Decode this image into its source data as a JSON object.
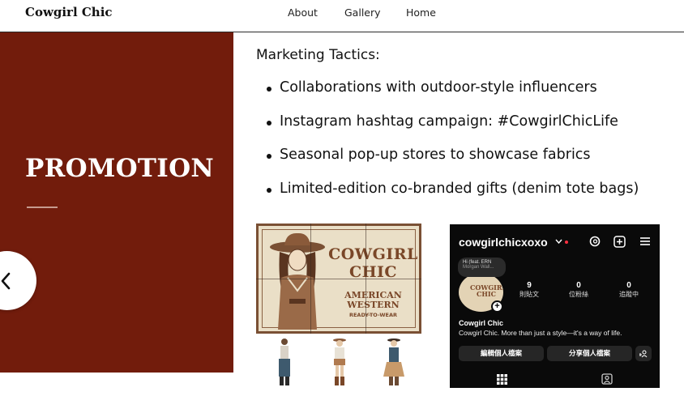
{
  "header": {
    "brand": "Cowgirl Chic",
    "nav": [
      {
        "label": "About"
      },
      {
        "label": "Gallery"
      },
      {
        "label": "Home"
      }
    ]
  },
  "promo": {
    "title": "PROMOTION",
    "prev_icon": "chevron-left-icon"
  },
  "tactics": {
    "heading": "Marketing Tactics:",
    "items": [
      "Collaborations with outdoor-style influencers",
      "Instagram hashtag campaign: #CowgirlChicLife",
      "Seasonal pop-up stores to showcase fabrics",
      "Limited-edition co-branded gifts (denim tote bags)"
    ]
  },
  "brand_board": {
    "logo_line1": "COWGIRL",
    "logo_line2": "CHIC",
    "sub_line1": "AMERICAN",
    "sub_line2": "WESTERN",
    "tagline": "READY-TO-WEAR",
    "colors": {
      "frame": "#7a5034",
      "ink": "#7a4728",
      "paper": "#eadfc7"
    }
  },
  "instagram": {
    "username": "cowgirlchicxoxo",
    "note_line1": "Hi  (feat. ERN",
    "note_line2": "Morgan Wall...",
    "avatar_text_1": "COWGIRL",
    "avatar_text_2": "CHIC",
    "stats": [
      {
        "num": "9",
        "label": "則貼文"
      },
      {
        "num": "0",
        "label": "位粉絲"
      },
      {
        "num": "0",
        "label": "追蹤中"
      }
    ],
    "display_name": "Cowgirl Chic",
    "bio": "Cowgirl Chic. More than just a style—it's a way of life.",
    "edit_button": "編輯個人檔案",
    "share_button": "分享個人檔案",
    "icons": [
      "threads-icon",
      "add-post-icon",
      "menu-icon",
      "add-person-icon",
      "grid-icon",
      "tagged-icon"
    ]
  },
  "colors": {
    "promo_bg": "#721c0c",
    "rule": "#c69a8e",
    "ig_bg": "#0a0a0a"
  }
}
